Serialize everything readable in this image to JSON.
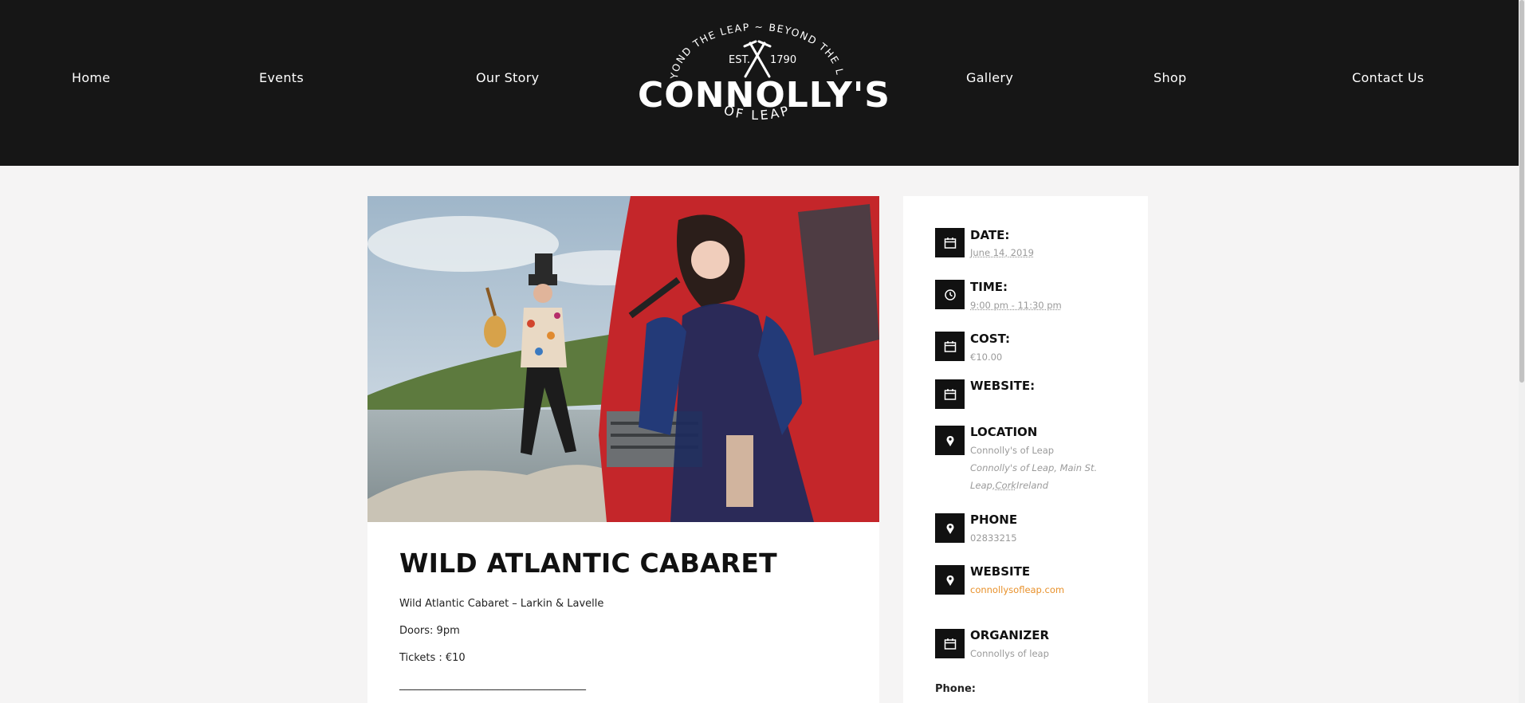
{
  "nav": {
    "home": "Home",
    "events": "Events",
    "our_story": "Our Story",
    "gallery": "Gallery",
    "shop": "Shop",
    "contact": "Contact Us"
  },
  "logo": {
    "arc_text": "BEYOND THE LEAP ~ BEYOND THE LAW",
    "est": "EST.",
    "year": "1790",
    "name": "CONNOLLY'S",
    "sub": "OF LEAP"
  },
  "event": {
    "title": "WILD ATLANTIC CABARET",
    "line1": "Wild Atlantic Cabaret – Larkin & Lavelle",
    "line2": "Doors: 9pm",
    "line3": "Tickets : €10",
    "divider": "____________________________________"
  },
  "meta": {
    "date_label": "DATE:",
    "date_value": "June 14, 2019",
    "time_label": "TIME:",
    "time_value": "9:00 pm - 11:30 pm",
    "cost_label": "COST:",
    "cost_value": "€10.00",
    "website_label": "WEBSITE:",
    "location_label": "LOCATION",
    "location_name": "Connolly's of Leap",
    "location_address_1": "Connolly's of Leap, Main St.",
    "location_address_2a": "Leap,",
    "location_address_2b": "Cork",
    "location_address_2c": "Ireland",
    "phone_label": "PHONE",
    "phone_value": "02833215",
    "website2_label": "WEBSITE",
    "website2_value": "connollysofleap.com",
    "organizer_label": "ORGANIZER",
    "organizer_value": "Connollys of leap",
    "phone_footer_label": "Phone:"
  },
  "colors": {
    "header_bg": "#161616",
    "page_bg": "#f5f4f4",
    "link": "#e8912b"
  }
}
